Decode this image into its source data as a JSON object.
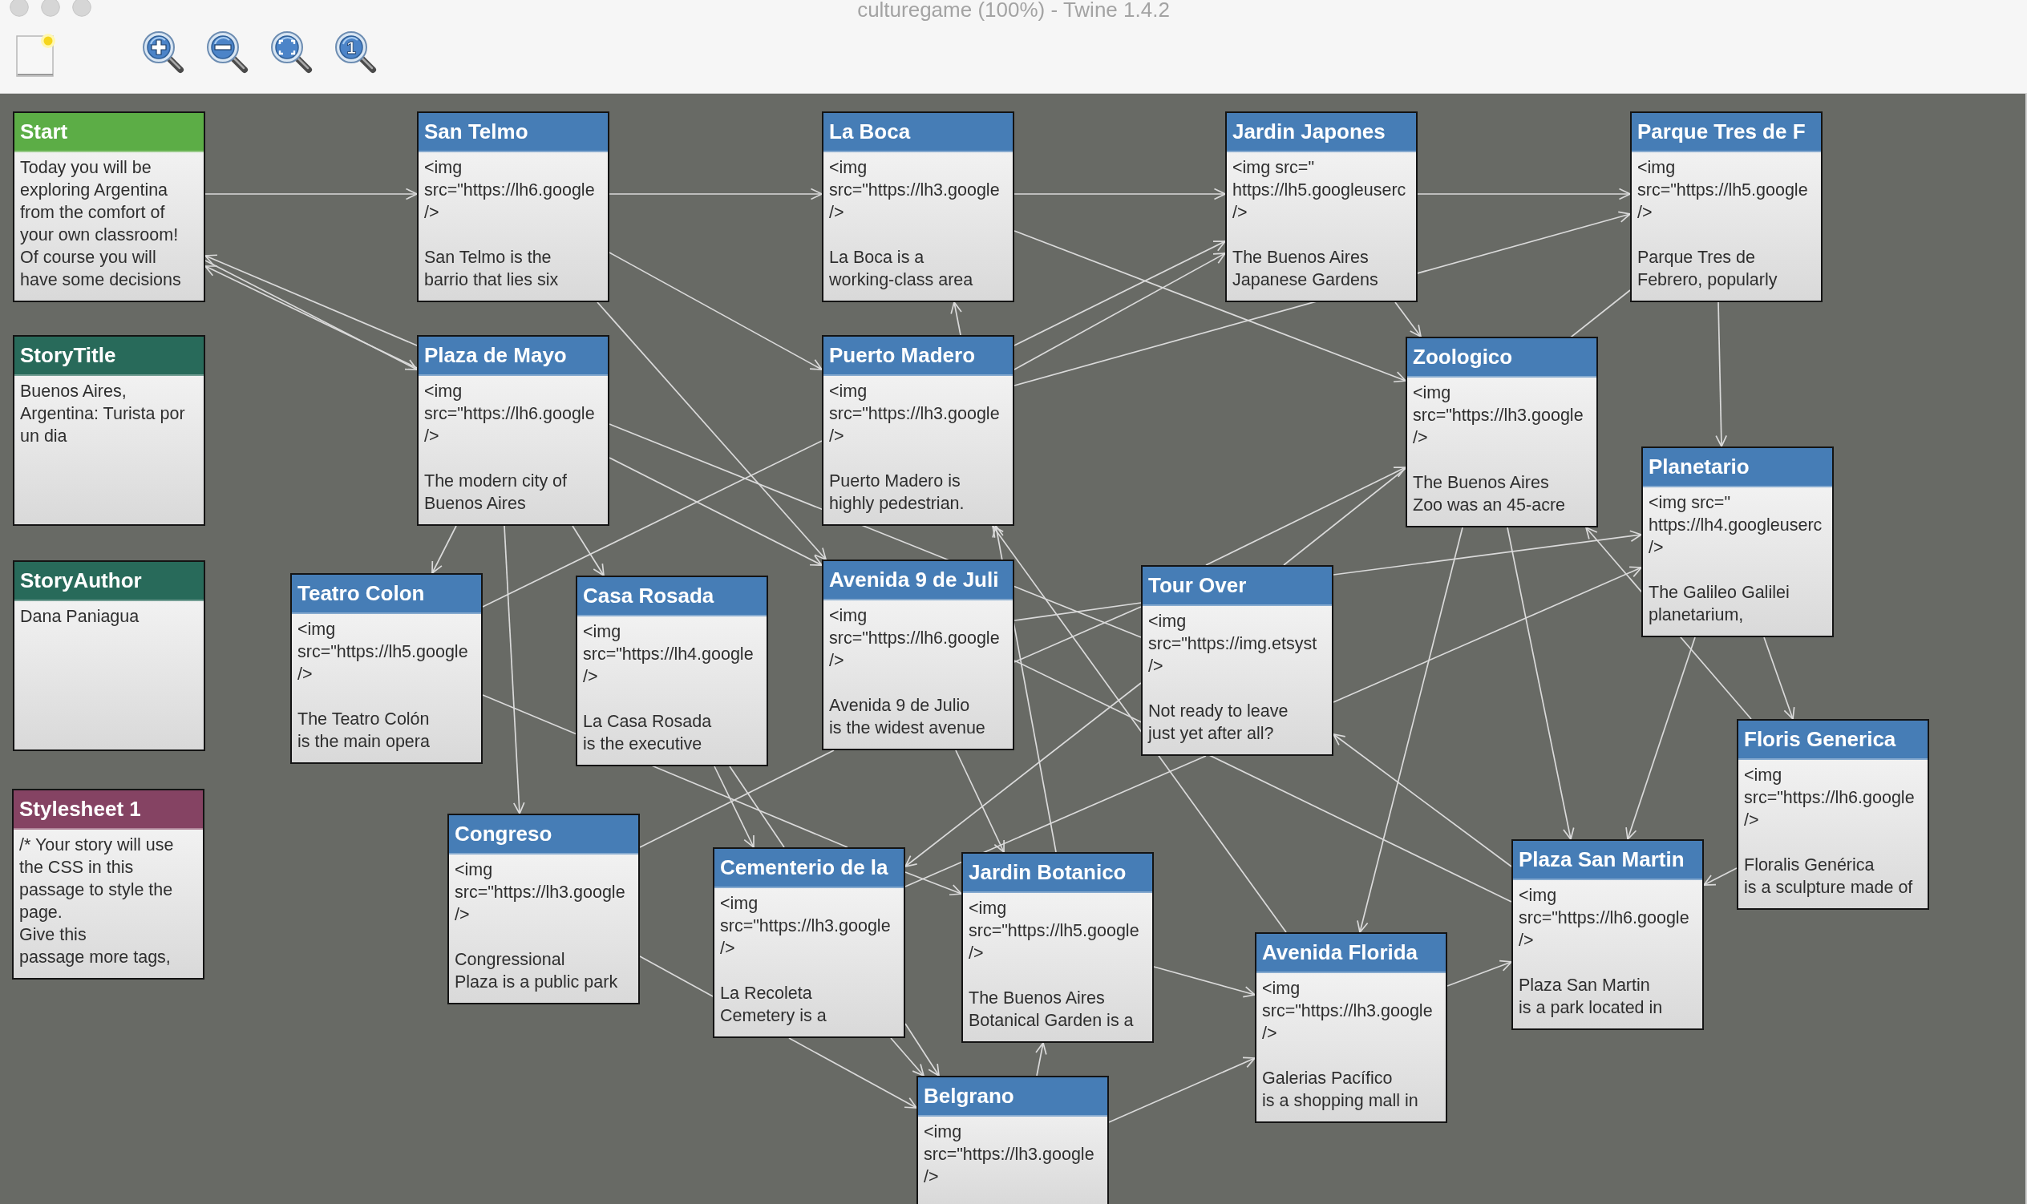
{
  "window": {
    "title": "culturegame (100%) - Twine 1.4.2"
  },
  "toolbar": [
    {
      "kind": "new-passage"
    },
    {
      "kind": "zoom-in"
    },
    {
      "kind": "zoom-out"
    },
    {
      "kind": "zoom-fit"
    },
    {
      "kind": "zoom-actual",
      "glyph": "1"
    }
  ],
  "passages": [
    {
      "title": "Start",
      "kind": "start",
      "excerpt": "Today you will be\nexploring Argentina\nfrom the comfort of\nyour own classroom!\nOf course you will\nhave some decisions"
    },
    {
      "title": "San Telmo",
      "kind": "normal",
      "excerpt": "<img\nsrc=\"https://lh6.google\n/>\n\nSan Telmo is the\nbarrio that lies six"
    },
    {
      "title": "La Boca",
      "kind": "normal",
      "excerpt": "<img\nsrc=\"https://lh3.google\n/>\n\nLa Boca is a\nworking-class area"
    },
    {
      "title": "Jardin Japones",
      "kind": "normal",
      "excerpt": "<img src=\"\nhttps://lh5.googleuserc\n/>\n\nThe Buenos Aires\nJapanese Gardens"
    },
    {
      "title": "Parque Tres de F",
      "kind": "normal",
      "excerpt": "<img\nsrc=\"https://lh5.google\n/>\n\nParque Tres de\nFebrero, popularly"
    },
    {
      "title": "StoryTitle",
      "kind": "special",
      "excerpt": "Buenos Aires,\nArgentina: Turista por\nun dia"
    },
    {
      "title": "Plaza de Mayo",
      "kind": "normal",
      "excerpt": "<img\nsrc=\"https://lh6.google\n/>\n\nThe modern city of\nBuenos Aires"
    },
    {
      "title": "Puerto Madero",
      "kind": "normal",
      "excerpt": "<img\nsrc=\"https://lh3.google\n/>\n\nPuerto Madero is\nhighly pedestrian."
    },
    {
      "title": "Zoologico",
      "kind": "normal",
      "excerpt": "<img\nsrc=\"https://lh3.google\n/>\n\nThe Buenos Aires\nZoo was an 45-acre"
    },
    {
      "title": "StoryAuthor",
      "kind": "special",
      "excerpt": "Dana Paniagua"
    },
    {
      "title": "Teatro Colon",
      "kind": "normal",
      "excerpt": "<img\nsrc=\"https://lh5.google\n/>\n\nThe Teatro Colón\nis the main opera"
    },
    {
      "title": "Casa Rosada",
      "kind": "normal",
      "excerpt": "<img\nsrc=\"https://lh4.google\n/>\n\nLa Casa Rosada\nis the executive"
    },
    {
      "title": "Avenida 9 de Juli",
      "kind": "normal",
      "excerpt": "<img\nsrc=\"https://lh6.google\n/>\n\nAvenida 9 de Julio\nis the widest avenue"
    },
    {
      "title": "Tour Over",
      "kind": "normal",
      "excerpt": "<img\nsrc=\"https://img.etsyst\n/>\n\nNot ready to leave\njust yet after all?"
    },
    {
      "title": "Planetario",
      "kind": "normal",
      "excerpt": "<img src=\"\nhttps://lh4.googleuserc\n/>\n\nThe Galileo Galilei\nplanetarium,"
    },
    {
      "title": "Floris Generica",
      "kind": "normal",
      "excerpt": "<img\nsrc=\"https://lh6.google\n/>\n\nFloralis Genérica\nis a sculpture made of"
    },
    {
      "title": "Stylesheet 1",
      "kind": "stylesheet",
      "excerpt": "/* Your story will use\nthe CSS in this\npassage to style the\npage.\nGive this\npassage more tags,"
    },
    {
      "title": "Congreso",
      "kind": "normal",
      "excerpt": "<img\nsrc=\"https://lh3.google\n/>\n\nCongressional\nPlaza is a public park"
    },
    {
      "title": "Cementerio de la",
      "kind": "normal",
      "excerpt": "<img\nsrc=\"https://lh3.google\n/>\n\nLa Recoleta\nCemetery is a"
    },
    {
      "title": "Jardin Botanico",
      "kind": "normal",
      "excerpt": "<img\nsrc=\"https://lh5.google\n/>\n\nThe Buenos Aires\nBotanical Garden is a"
    },
    {
      "title": "Plaza San Martin",
      "kind": "normal",
      "excerpt": "<img\nsrc=\"https://lh6.google\n/>\n\nPlaza San Martin\nis a park located in"
    },
    {
      "title": "Avenida Florida",
      "kind": "normal",
      "excerpt": "<img\nsrc=\"https://lh3.google\n/>\n\nGalerias Pacífico\nis a shopping mall in"
    },
    {
      "title": "Belgrano",
      "kind": "normal",
      "excerpt": "<img\nsrc=\"https://lh3.google\n/>"
    }
  ]
}
